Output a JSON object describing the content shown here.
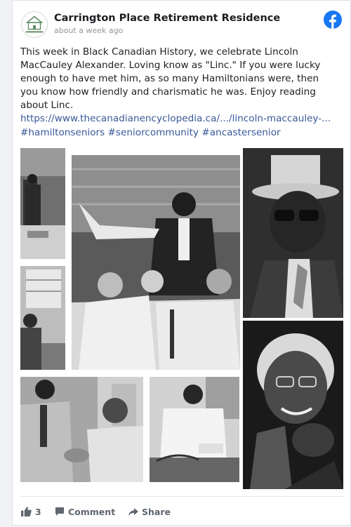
{
  "post": {
    "page_name": "Carrington Place Retirement Residence",
    "timestamp": "about a week ago",
    "avatar_text": "Carrington",
    "text_lines": [
      "This week in Black Canadian History, we celebrate Lincoln",
      "MacCauley Alexander. Loving know as \"Linc.\" If you were lucky",
      "enough to have met him, as so many Hamiltonians were, then",
      "you know how friendly and charismatic he was. Enjoy reading",
      "about Linc."
    ],
    "link": "https://www.thecanadianencyclopedia.ca/.../lincoln-maccauley-...",
    "hashtags": "#hamiltonseniors #seniorcommunity #ancastersenior"
  },
  "actions": {
    "like_count": "3",
    "comment_label": "Comment",
    "share_label": "Share"
  },
  "icons": {
    "brand": "facebook-icon",
    "like": "thumbs-up-icon",
    "comment": "comment-icon",
    "share": "share-icon"
  },
  "colors": {
    "facebook_blue": "#1877f2",
    "link": "#385898",
    "brand_green": "#5a8a62"
  }
}
